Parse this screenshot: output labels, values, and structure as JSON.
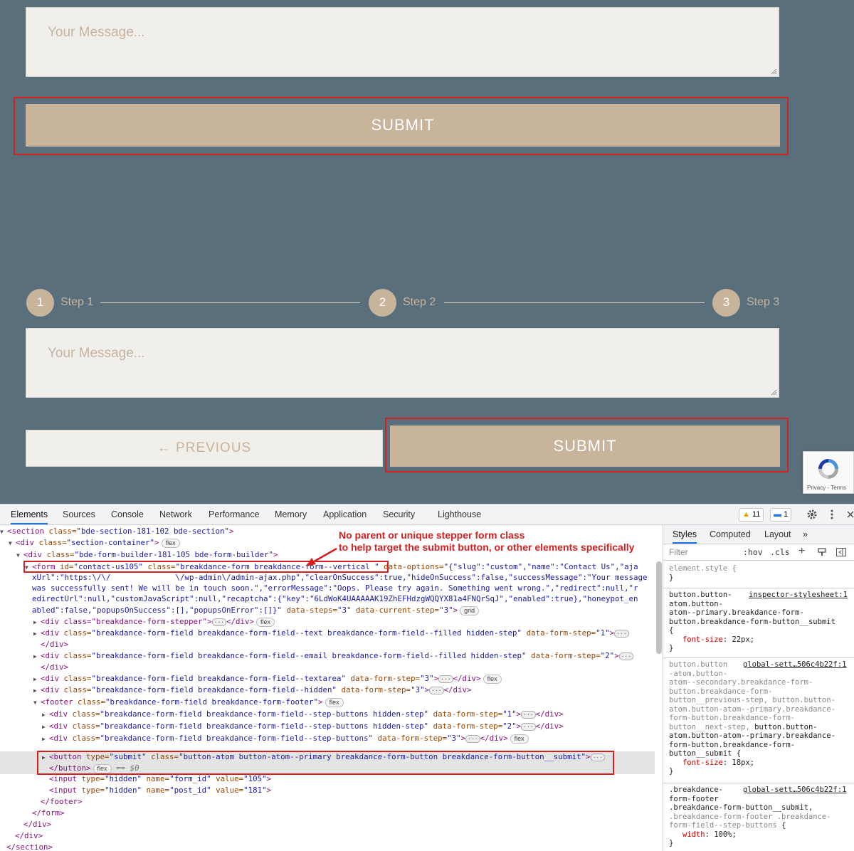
{
  "preview": {
    "message_placeholder": "Your Message...",
    "submit_label": "SUBMIT",
    "previous_label": "← PREVIOUS",
    "steps": [
      {
        "number": "1",
        "label": "Step 1"
      },
      {
        "number": "2",
        "label": "Step 2"
      },
      {
        "number": "3",
        "label": "Step 3"
      }
    ],
    "recaptcha_text": "Privacy - Terms",
    "accent_color": "#c8b39b",
    "background_color": "#5a6f7c",
    "highlight_color": "#d61f1f"
  },
  "devtools": {
    "tabs": [
      "Elements",
      "Sources",
      "Console",
      "Network",
      "Performance",
      "Memory",
      "Application",
      "Security",
      "Lighthouse"
    ],
    "active_tab": "Elements",
    "warnings_count": "11",
    "messages_count": "1",
    "annotation_line1": "No parent or unique stepper form class",
    "annotation_line2": "to help target the submit button, or other elements specifically",
    "dom_lines": {
      "l0_open": "<section",
      "l0_attr": " class=",
      "l0_val": "\"bde-section-181-102 bde-section\"",
      "l0_close": ">",
      "l1_open": "<div",
      "l1_attr": " class=",
      "l1_val": "\"section-container\"",
      "l1_close": ">",
      "l2_open": "<div",
      "l2_attr": " class=",
      "l2_val": "\"bde-form-builder-181-105 bde-form-builder\"",
      "l2_close": ">",
      "l3_open": "<form",
      "l3_attr1": " id=",
      "l3_val1": "\"contact-us105\"",
      "l3_attr2": " class=",
      "l3_val2": "\"breakdance-form breakdance-form--vertical \"",
      "l3_attr3": " data-options=",
      "l3_val3": "\"{\"slug\":\"custom\",\"name\":\"Contact Us\",\"aja",
      "l3b": "xUrl\":\"https:\\/\\/              \\/wp-admin\\/admin-ajax.php\",\"clearOnSuccess\":true,\"hideOnSuccess\":false,\"successMessage\":\"Your message",
      "l3c": "was successfully sent! We will be in touch soon.\",\"errorMessage\":\"Oops. Please try again. Something went wrong.\",\"redirect\":null,\"r",
      "l3d": "edirectUrl\":null,\"customJavaScript\":null,\"recaptcha\":{\"key\":\"6LdWoK4UAAAAAK19ZhEFHdzgWQQYX81a4FNQrSqJ\",\"enabled\":true},\"honeypot_en",
      "l3e_val": "abled\":false,\"popupsOnSuccess\":[],\"popupsOnError\":[]}\"",
      "l3e_attr": " data-steps=",
      "l3e_val2": "\"3\"",
      "l3e_attr2": " data-current-step=",
      "l3e_val3": "\"3\"",
      "l3e_close": ">",
      "l4": "<div class=\"breakdance-form-stepper\">",
      "l4_end": "</div>",
      "l5_a": "<div",
      "l5_attr": " class=",
      "l5_val": "\"breakdance-form-field breakdance-form-field--text breakdance-form-field--filled hidden-step\"",
      "l5_attr2": " data-form-step=",
      "l5_val2": "\"1\"",
      "l5_close": ">",
      "l6": "</div>",
      "l7_a": "<div",
      "l7_attr": " class=",
      "l7_val": "\"breakdance-form-field breakdance-form-field--email breakdance-form-field--filled hidden-step\"",
      "l7_attr2": " data-form-step=",
      "l7_val2": "\"2\"",
      "l7_close": ">",
      "l8": "</div>",
      "l9_a": "<div",
      "l9_attr": " class=",
      "l9_val": "\"breakdance-form-field breakdance-form-field--textarea\"",
      "l9_attr2": " data-form-step=",
      "l9_val2": "\"3\"",
      "l9_close": ">",
      "l9_end": "</div>",
      "l10_a": "<div",
      "l10_attr": " class=",
      "l10_val": "\"breakdance-form-field breakdance-form-field--hidden\"",
      "l10_attr2": " data-form-step=",
      "l10_val2": "\"3\"",
      "l10_close": ">",
      "l10_end": "</div>",
      "l11_a": "<footer",
      "l11_attr": " class=",
      "l11_val": "\"breakdance-form-field breakdance-form-footer\"",
      "l11_close": ">",
      "l12_a": "<div",
      "l12_attr": " class=",
      "l12_val": "\"breakdance-form-field breakdance-form-field--step-buttons hidden-step\"",
      "l12_attr2": " data-form-step=",
      "l12_val2": "\"1\"",
      "l12_close": ">",
      "l12_end": "</div>",
      "l13_val2": "\"2\"",
      "l14_val": "\"breakdance-form-field breakdance-form-field--step-buttons\"",
      "l14_val2": "\"3\"",
      "l15_a": "<button",
      "l15_attr": " type=",
      "l15_val": "\"submit\"",
      "l15_attr2": " class=",
      "l15_val2": "\"button-atom button-atom--primary breakdance-form-button breakdance-form-button__submit\"",
      "l15_close": ">",
      "l16": "</button>",
      "l16_eq": " == $0",
      "l17_a": "<input",
      "l17_attr": " type=",
      "l17_val": "\"hidden\"",
      "l17_attr2": " name=",
      "l17_val2": "\"form_id\"",
      "l17_attr3": " value=",
      "l17_val3": "\"105\"",
      "l17_close": ">",
      "l18_val2": "\"post_id\"",
      "l18_val3": "\"181\"",
      "l19": "</footer>",
      "l20": "</form>",
      "l21": "</div>",
      "l22": "</div>",
      "l23": "</section>",
      "pill_flex": "flex",
      "pill_grid": "grid",
      "ellipsis": "···"
    },
    "styles_tabs": [
      "Styles",
      "Computed",
      "Layout",
      "»"
    ],
    "filter_placeholder": "Filter",
    "filter_hov": ":hov",
    "filter_cls": ".cls",
    "rules": {
      "r0": "element.style {",
      "r0_end": "}",
      "r1_sel": "button.button-\natom.button-\natom--primary.breakdance-form-\nbutton.breakdance-form-button__submit\n{",
      "r1_src": "inspector-stylesheet:1",
      "r1_prop": "font-size",
      "r1_val": ": 22px;",
      "r1_end": "}",
      "r2_dim": "button.button\n-atom.button-\natom--secondary.breakdance-form-\nbutton.breakdance-form-\nbutton__previous-step, button.button-\natom.button-atom--primary.breakdance-\nform-button.breakdance-form-\nbutton__next-step,",
      "r2_sel": " button.button-\natom.button-atom--primary.breakdance-\nform-button.breakdance-form-\nbutton__submit {",
      "r2_src": "global-sett…506c4b22f:1",
      "r2_prop": "font-size",
      "r2_val": ": 18px;",
      "r2_end": "}",
      "r3_sel": ".breakdance-\nform-footer\n.breakdance-form-button__submit,",
      "r3_dim": ".breakdance-form-footer .breakdance-\nform-field--step-buttons",
      "r3_brace": " {",
      "r3_src": "global-sett…506c4b22f:1",
      "r3_prop": "width",
      "r3_val": ": 100%;",
      "r3_end": "}"
    }
  }
}
